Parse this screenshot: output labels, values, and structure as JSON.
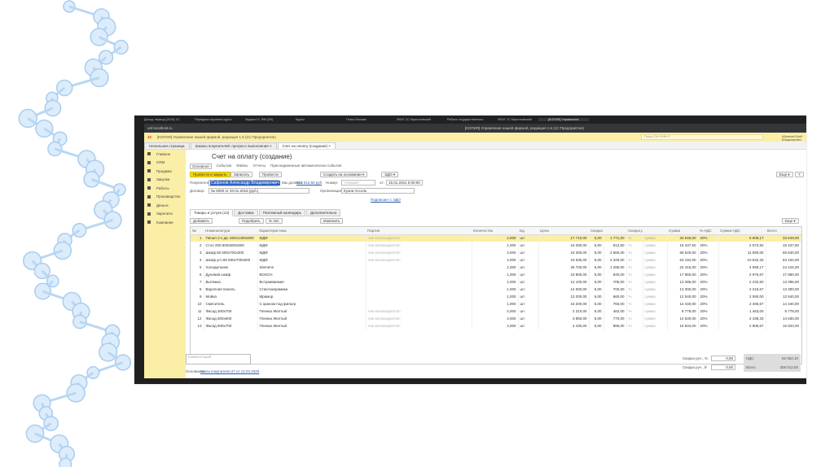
{
  "browser": {
    "tabs": [
      "Доход. период (2019) 1С",
      "Передача изучения курса",
      "Задачи 1С ФМ (2Ф)",
      "Курсы",
      "Поиск Москва",
      "ФЛАГ 1С Кирилловский",
      "Работа государственного",
      "ФЛАГ 1С Кирилловский",
      "[КОПИЯ] Управление"
    ],
    "window_title": "[КОПИЯ] Управление нашей фирмой, редакция 1.6 (1С:Предприятие)",
    "address": "unf.localhost.ru"
  },
  "app": {
    "logo": "1С",
    "title": "[КОПИЯ] Управление нашей фирмой, редакция 1.6 (1С:Предприятие)",
    "search_placeholder": "Поиск Ctrl+Shift+F",
    "user": "Абрамов Юрий Владимирович"
  },
  "tabs": [
    {
      "label": "Начальная страница"
    },
    {
      "label": "Заказы покупателей: прогресс выполнения ×"
    },
    {
      "label": "Счет на оплату (создание) ×"
    }
  ],
  "sidebar": {
    "items": [
      "Главное",
      "CRM",
      "Продажи",
      "Закупки",
      "Работы",
      "Производство",
      "Деньги",
      "Зарплата",
      "Компания"
    ]
  },
  "doc": {
    "title": "Счет на оплату (создание)",
    "links": [
      "Основное",
      "События",
      "Файлы",
      "Отчеты",
      "Присоединенные автоматически события"
    ],
    "buttons": {
      "post_close": "Провести и закрыть",
      "save": "Записать",
      "post": "Провести",
      "create_based": "Создать на основании ▾",
      "edo": "ЭДО ▾",
      "more": "Еще ▾",
      "help": "?"
    },
    "fields": {
      "buyer_label": "Покупатель:",
      "buyer": "Сафонов Александр Владимирович",
      "debt_label": "Мы должны:",
      "debt": "315 012,50 руб",
      "number_label": "Номер:",
      "number_placeholder": "<Новый>",
      "date_label": "от:",
      "date": "15.01.2021 0:00:00",
      "contract_label": "Договор:",
      "contract": "№ 0000 от 20.01.2015 (руб.)",
      "org_label": "Организация:",
      "org": "Кухни Ассоль",
      "signer_link": "Подписант с ЭДО"
    },
    "inner_tabs": [
      "Товары и услуги (13)",
      "Доставка",
      "Платежный календарь",
      "Дополнительно"
    ],
    "table_buttons": {
      "add": "Добавить",
      "pick": "Подобрать",
      "auto": "% Авт",
      "change": "Изменить",
      "more": "Еще ▾"
    },
    "columns": [
      "№",
      "Номенклатура",
      "Характеристика",
      "Партия",
      "Количество",
      "Ед.",
      "Цена",
      "Скидка авт.",
      "",
      "Скидка руч.",
      "",
      "Сумма",
      "% НДС",
      "Сумма НДС",
      "Всего"
    ],
    "rows": [
      [
        "1",
        "Пенал 2-х дв. 600х1400х600",
        "МДФ",
        "<не используются>",
        "2,000",
        "шт",
        "17 710,00",
        "5,00",
        "1 771,00",
        "%",
        "сумма",
        "33 649,00",
        "20%",
        "5 608,17",
        "33 649,00"
      ],
      [
        "2",
        "Стол 200.600х600х600",
        "МДФ",
        "<не используются>",
        "1,000",
        "шт",
        "16 250,00",
        "5,00",
        "812,50",
        "%",
        "сумма",
        "15 437,50",
        "20%",
        "2 572,92",
        "15 437,50"
      ],
      [
        "3",
        "Шкаф 60 600х700х300",
        "МДФ",
        "<не используются>",
        "4,000",
        "шт",
        "18 300,00",
        "5,00",
        "3 660,00",
        "%",
        "сумма",
        "69 540,00",
        "20%",
        "11 590,00",
        "69 540,00"
      ],
      [
        "4",
        "Шкаф угл.60 600х700х600",
        "МДФ",
        "<не используются>",
        "4,000",
        "шт",
        "16 635,00",
        "5,00",
        "3 328,00",
        "%",
        "сумма",
        "63 194,00",
        "20%",
        "10 532,33",
        "63 194,00"
      ],
      [
        "5",
        "Холодильник",
        "Siemens",
        "",
        "1,000",
        "шт",
        "25 700,00",
        "5,00",
        "1 285,00",
        "%",
        "сумма",
        "24 415,00",
        "20%",
        "4 069,17",
        "24 415,00"
      ],
      [
        "6",
        "Духовой шкаф",
        "BOSCH",
        "",
        "1,000",
        "шт",
        "18 800,00",
        "5,00",
        "940,00",
        "%",
        "сумма",
        "17 860,00",
        "20%",
        "2 976,67",
        "17 860,00"
      ],
      [
        "7",
        "Вытяжка",
        "Встраиваемая",
        "",
        "1,000",
        "шт",
        "14 100,00",
        "5,00",
        "705,00",
        "%",
        "сумма",
        "13 395,00",
        "20%",
        "2 232,50",
        "13 395,00"
      ],
      [
        "8",
        "Варочная панель",
        "Стеклокерамика",
        "",
        "1,000",
        "шт",
        "14 000,00",
        "5,00",
        "700,00",
        "%",
        "сумма",
        "13 300,00",
        "20%",
        "2 216,67",
        "13 300,00"
      ],
      [
        "9",
        "Мойка",
        "Мрамор",
        "",
        "1,000",
        "шт",
        "13 200,00",
        "5,00",
        "660,00",
        "%",
        "сумма",
        "12 540,00",
        "20%",
        "2 090,00",
        "12 540,00"
      ],
      [
        "10",
        "Смеситель",
        "С краном под фильтр",
        "",
        "1,000",
        "шт",
        "15 200,00",
        "5,00",
        "760,00",
        "%",
        "сумма",
        "14 440,00",
        "20%",
        "2 406,67",
        "14 440,00"
      ],
      [
        "11",
        "Фасад 300х700",
        "Пленка Желтый",
        "<не используются>",
        "4,000",
        "шт",
        "2 310,00",
        "5,00",
        "462,00",
        "%",
        "сумма",
        "8 778,00",
        "20%",
        "1 463,00",
        "8 778,00"
      ],
      [
        "12",
        "Фасад 600х600",
        "Пленка Желтый",
        "<не используются>",
        "4,000",
        "шт",
        "3 850,00",
        "5,00",
        "770,00",
        "%",
        "сумма",
        "14 630,00",
        "20%",
        "2 438,33",
        "14 630,00"
      ],
      [
        "13",
        "Фасад 600х700",
        "Пленка Желтый",
        "<не используются>",
        "4,000",
        "шт",
        "4 430,00",
        "5,00",
        "886,00",
        "%",
        "сумма",
        "16 834,00",
        "20%",
        "2 805,67",
        "16 834,00"
      ]
    ],
    "comment_placeholder": "Комментарий",
    "basis_label": "Основание:",
    "basis_link": "Заказ покупателя 27 от 12.04.2020",
    "totals": {
      "disc_pct_label": "Скидка руч., %",
      "disc_pct": "0,00",
      "disc_sum_label": "Скидка руч., ₽",
      "disc_sum": "0,00",
      "vat_label": "НДС",
      "vat": "52 002,10",
      "total_label": "Всего",
      "total": "308 012,50"
    }
  },
  "colors": {
    "accent": "#f5d90a",
    "header": "#fbeea6",
    "selection": "#3c78d8",
    "decor": "#a9cdf0"
  }
}
